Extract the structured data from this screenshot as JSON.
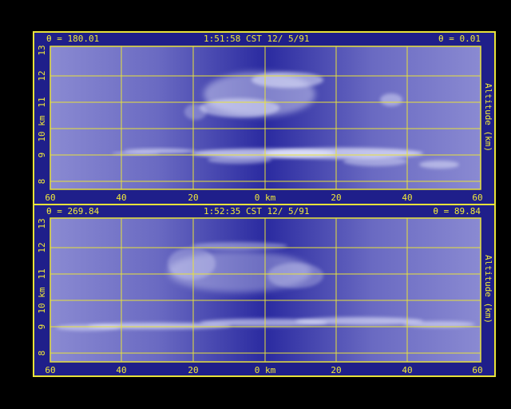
{
  "panels": [
    {
      "angle_left": "θ = 180.01",
      "time": "1:51:58 CST 12/ 5/91",
      "angle_right": "θ = 0.01",
      "x_ticks": [
        "60",
        "40",
        "20",
        "0 km",
        "20",
        "40",
        "60"
      ],
      "y_ticks": [
        "8",
        "9",
        "10",
        "11",
        "12",
        "13"
      ],
      "y_axis_left": "10 km",
      "y_axis_right": "Altitude (km)"
    },
    {
      "angle_left": "θ = 269.84",
      "time": "1:52:35 CST 12/ 5/91",
      "angle_right": "θ = 89.84",
      "x_ticks": [
        "60",
        "40",
        "20",
        "0 km",
        "20",
        "40",
        "60"
      ],
      "y_ticks": [
        "8",
        "9",
        "10",
        "11",
        "12",
        "13"
      ],
      "y_axis_left": "10 km",
      "y_axis_right": "Altitude (km)"
    }
  ],
  "colors": {
    "background": "#000000",
    "frame": "#1f1f8a",
    "grid": "#e8e23a",
    "text": "#f2ea3a",
    "sky_center": "#2a2aa0",
    "sky_edge": "#8585cf",
    "cloud": "#e9ecff"
  }
}
